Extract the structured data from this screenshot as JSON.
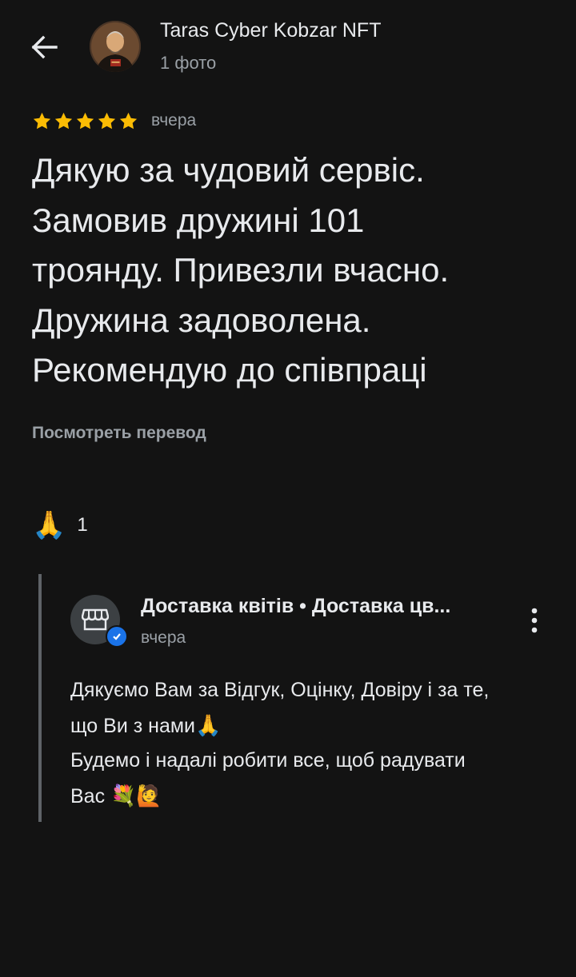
{
  "header": {
    "back_icon": "arrow-back-icon",
    "author_name": "Taras Cyber Kobzar NFT",
    "author_subtitle": "1 фото",
    "avatar_icon": "profile-photo"
  },
  "review": {
    "rating": 5,
    "rating_max": 5,
    "star_color": "#fbbc04",
    "date": "вчера",
    "text_lines": [
      "Дякую за чудовий сервіс.",
      "Замовив дружині 101",
      "троянду. Привезли вчасно.",
      "Дружина задоволена.",
      "Рекомендую до співпраці"
    ],
    "translate_link": "Посмотреть перевод"
  },
  "reaction": {
    "emoji": "🙏",
    "count": "1"
  },
  "owner_reply": {
    "name": "Доставка квітів • Доставка цв...",
    "date": "вчера",
    "avatar_icon": "storefront-icon",
    "verified_icon": "verified-check-icon",
    "more_icon": "more-vert-icon",
    "lines": [
      {
        "text": "Дякуємо Вам за Відгук, Оцінку, Довіру і за те,",
        "emoji": ""
      },
      {
        "text": "що Ви з нами",
        "emoji": "🙏"
      },
      {
        "text": "Будемо і надалі робити все, щоб радувати",
        "emoji": ""
      },
      {
        "text": "Вас ",
        "emoji": "💐🙋"
      }
    ]
  },
  "colors": {
    "background": "#131313",
    "primary_text": "#e8eaed",
    "secondary_text": "#9aa0a6",
    "accent_blue": "#1a73e8",
    "reply_border": "#5f6368"
  }
}
